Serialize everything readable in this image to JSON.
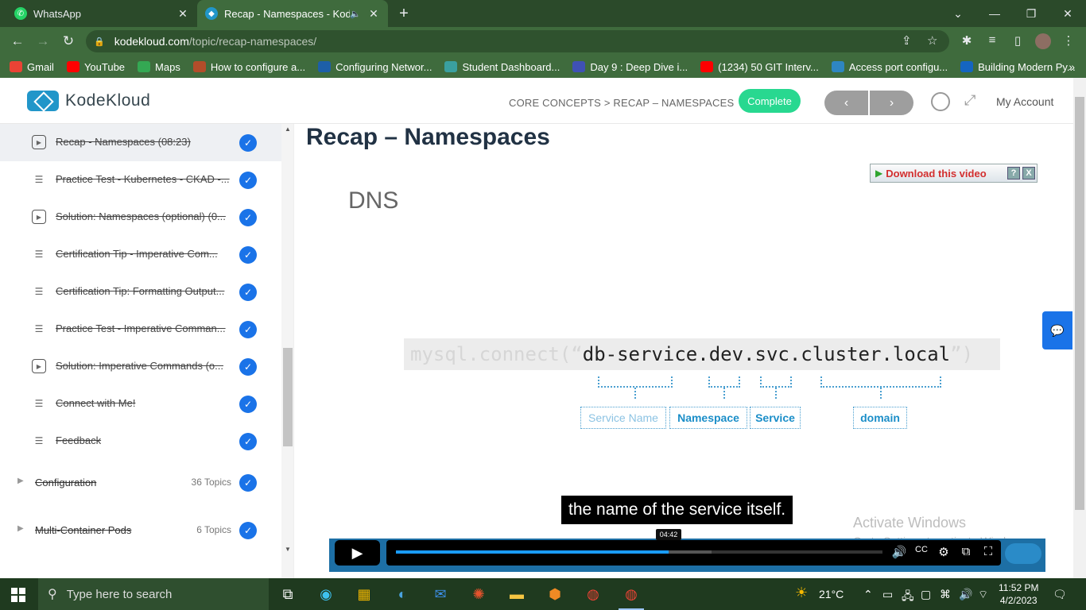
{
  "browser": {
    "tabs": [
      {
        "title": "WhatsApp",
        "icon": "whatsapp-icon"
      },
      {
        "title": "Recap - Namespaces - KodeKl",
        "icon": "kodekloud-icon",
        "audio": true
      }
    ],
    "url_host": "kodekloud.com",
    "url_path": "/topic/recap-namespaces/",
    "bookmarks": [
      {
        "label": "Gmail",
        "icon": "gmail-icon",
        "color": "#ea4335"
      },
      {
        "label": "YouTube",
        "icon": "youtube-icon",
        "color": "#ff0000"
      },
      {
        "label": "Maps",
        "icon": "maps-icon",
        "color": "#34a853"
      },
      {
        "label": "How to configure a...",
        "icon": "page-icon",
        "color": "#b34d2a"
      },
      {
        "label": "Configuring Networ...",
        "icon": "vmware-icon",
        "color": "#1d5fa8"
      },
      {
        "label": "Student Dashboard...",
        "icon": "dashboard-icon",
        "color": "#3aa0a0"
      },
      {
        "label": "Day 9 : Deep Dive i...",
        "icon": "diamond-icon",
        "color": "#3f51b5"
      },
      {
        "label": "(1234) 50 GIT Interv...",
        "icon": "youtube-icon",
        "color": "#ff0000"
      },
      {
        "label": "Access port configu...",
        "icon": "cisco-icon",
        "color": "#2e86c1"
      },
      {
        "label": "Building Modern Py...",
        "icon": "c-icon",
        "color": "#1565c0"
      }
    ]
  },
  "header": {
    "logo_text": "KodeKloud",
    "breadcrumb": "CORE CONCEPTS > RECAP – NAMESPACES",
    "complete_label": "Complete",
    "prev_label": "‹",
    "next_label": "›",
    "account_label": "My Account",
    "accent": "#28d890"
  },
  "sidebar": {
    "lessons": [
      {
        "label": "Recap - Namespaces (08:23)",
        "type": "video",
        "current": true
      },
      {
        "label": "Practice Test - Kubernetes - CKAD -...",
        "type": "text"
      },
      {
        "label": "Solution: Namespaces (optional) (0...",
        "type": "video"
      },
      {
        "label": "Certification Tip - Imperative Com...",
        "type": "text"
      },
      {
        "label": "Certification Tip: Formatting Output...",
        "type": "text"
      },
      {
        "label": "Practice Test - Imperative Comman...",
        "type": "text"
      },
      {
        "label": "Solution: Imperative Commands (o...",
        "type": "video"
      },
      {
        "label": "Connect with Me!",
        "type": "text"
      },
      {
        "label": "Feedback",
        "type": "text"
      }
    ],
    "sections": [
      {
        "title": "Configuration",
        "count": "36 Topics"
      },
      {
        "title": "Multi-Container Pods",
        "count": "6 Topics"
      }
    ]
  },
  "content": {
    "title": "Recap – Namespaces",
    "download_label": "Download this video",
    "download_help": "?",
    "download_close": "X",
    "slide": {
      "heading": "DNS",
      "code_prefix": "mysql.connect(“",
      "code_host": "db-service.dev.svc.cluster.local",
      "code_suffix": "”)",
      "labels": [
        "Service Name",
        "Namespace",
        "Service",
        "domain"
      ]
    },
    "caption": "the name of the service itself.",
    "player": {
      "time": "04:42",
      "progress": 0.56
    }
  },
  "watermark": {
    "line1": "Activate Windows",
    "line2": "Go to Settings to activate Windows."
  },
  "taskbar": {
    "search_placeholder": "Type here to search",
    "weather": "21°C",
    "time": "11:52 PM",
    "date": "4/2/2023"
  }
}
